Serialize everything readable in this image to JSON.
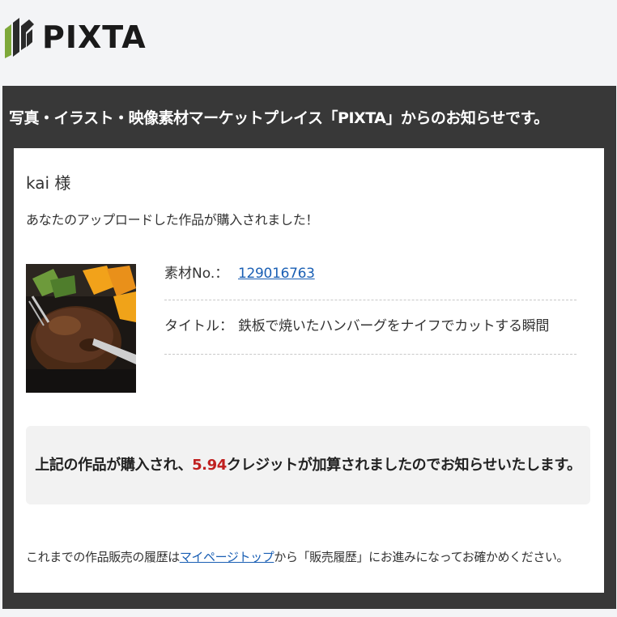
{
  "brand": {
    "logo_text": "PIXTA",
    "logo_icon": "pixta-logo-icon"
  },
  "header": {
    "title": "写真・イラスト・映像素材マーケットプレイス「PIXTA」からのお知らせです。"
  },
  "message": {
    "greeting": "kai  様",
    "intro": "あなたのアップロードした作品が購入されました！"
  },
  "item": {
    "thumbnail": "hamburger-steak-photo",
    "material_label": "素材No.：",
    "material_number": "129016763",
    "title_label": "タイトル：",
    "title_value": "鉄板で焼いたハンバーグをナイフでカットする瞬間"
  },
  "notice": {
    "prefix": "上記の作品が購入され、",
    "credit_amount": "5.94",
    "suffix": "クレジットが加算されましたのでお知らせいたします。"
  },
  "footer": {
    "prefix": "これまでの作品販売の履歴は",
    "link_text": "マイページトップ",
    "suffix": "から「販売履歴」にお進みになってお確かめください。"
  },
  "colors": {
    "frame": "#383838",
    "credit": "#c0201f",
    "link": "#1a5fb4"
  }
}
